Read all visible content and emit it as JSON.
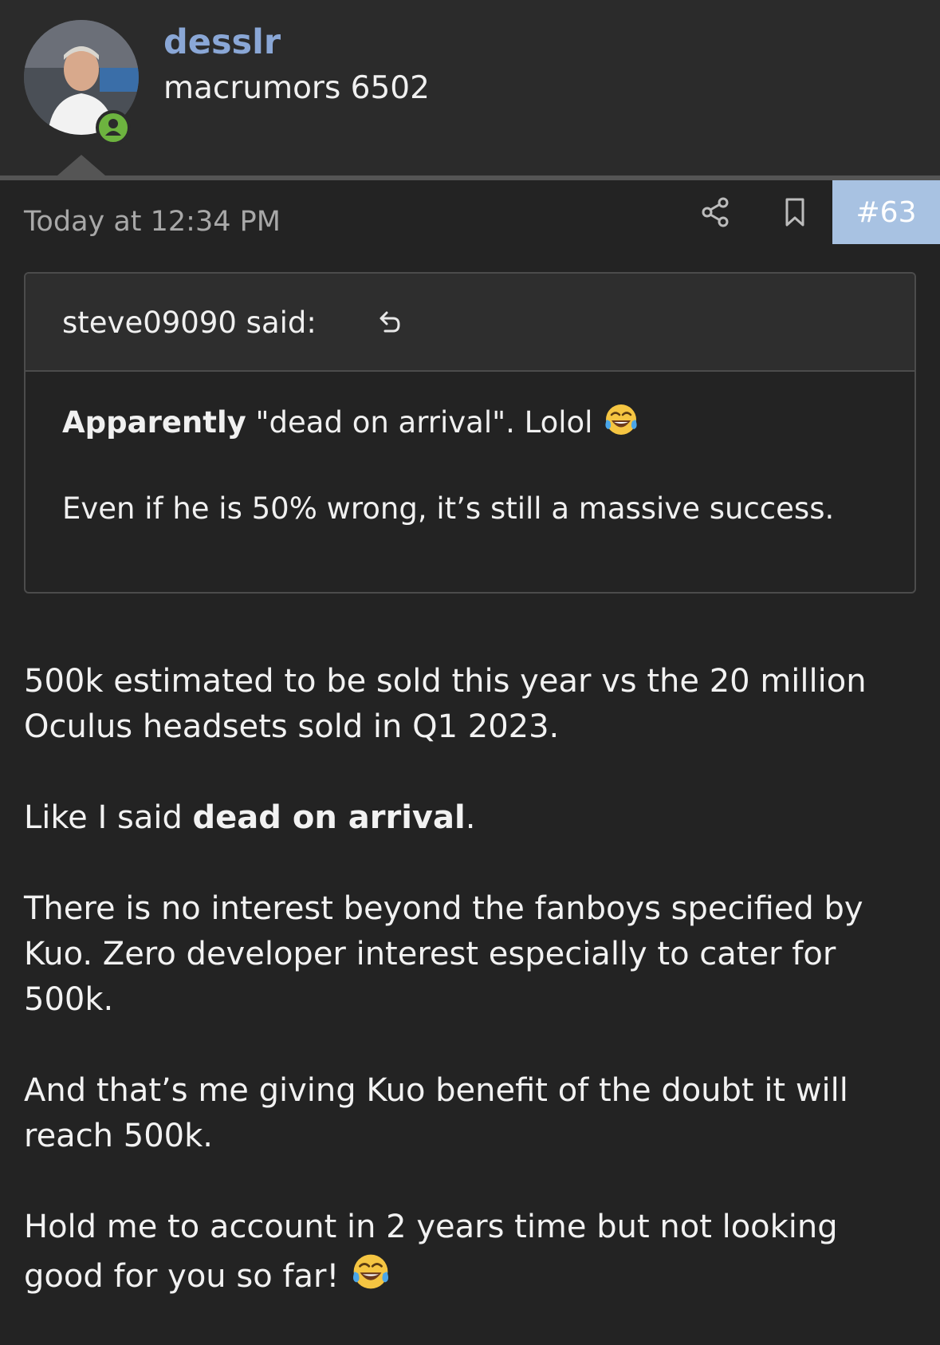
{
  "author": {
    "username": "desslr",
    "title": "macrumors 6502"
  },
  "post": {
    "timestamp": "Today at 12:34 PM",
    "number": "#63"
  },
  "quote": {
    "author_said": "steve09090 said:",
    "line1_bold": "Apparently",
    "line1_rest": " \"dead on arrival\". Lolol",
    "line2": "Even if he is 50% wrong, it’s still a massive success."
  },
  "body": {
    "p1": "500k estimated to be sold this year vs the 20 million Oculus headsets sold in Q1 2023.",
    "p2_pre": "Like I said ",
    "p2_bold": "dead on arrival",
    "p2_post": ".",
    "p3": "There is no interest beyond the fanboys specified by Kuo. Zero developer interest especially to cater for 500k.",
    "p4": "And that’s me giving Kuo benefit of the doubt it will reach 500k.",
    "p5": "Hold me to account in 2 years time but not looking good for you so far!"
  },
  "icons": {
    "share": "share-icon",
    "bookmark": "bookmark-icon",
    "quote_jump": "undo-arrow-icon",
    "emoji": "face-with-tears-of-joy-emoji",
    "online": "user-online-icon"
  },
  "colors": {
    "background": "#232323",
    "header_bg": "#2b2b2b",
    "username": "#8aa7d6",
    "post_number_bg": "#a8c2e2",
    "online_green": "#6db33f"
  }
}
